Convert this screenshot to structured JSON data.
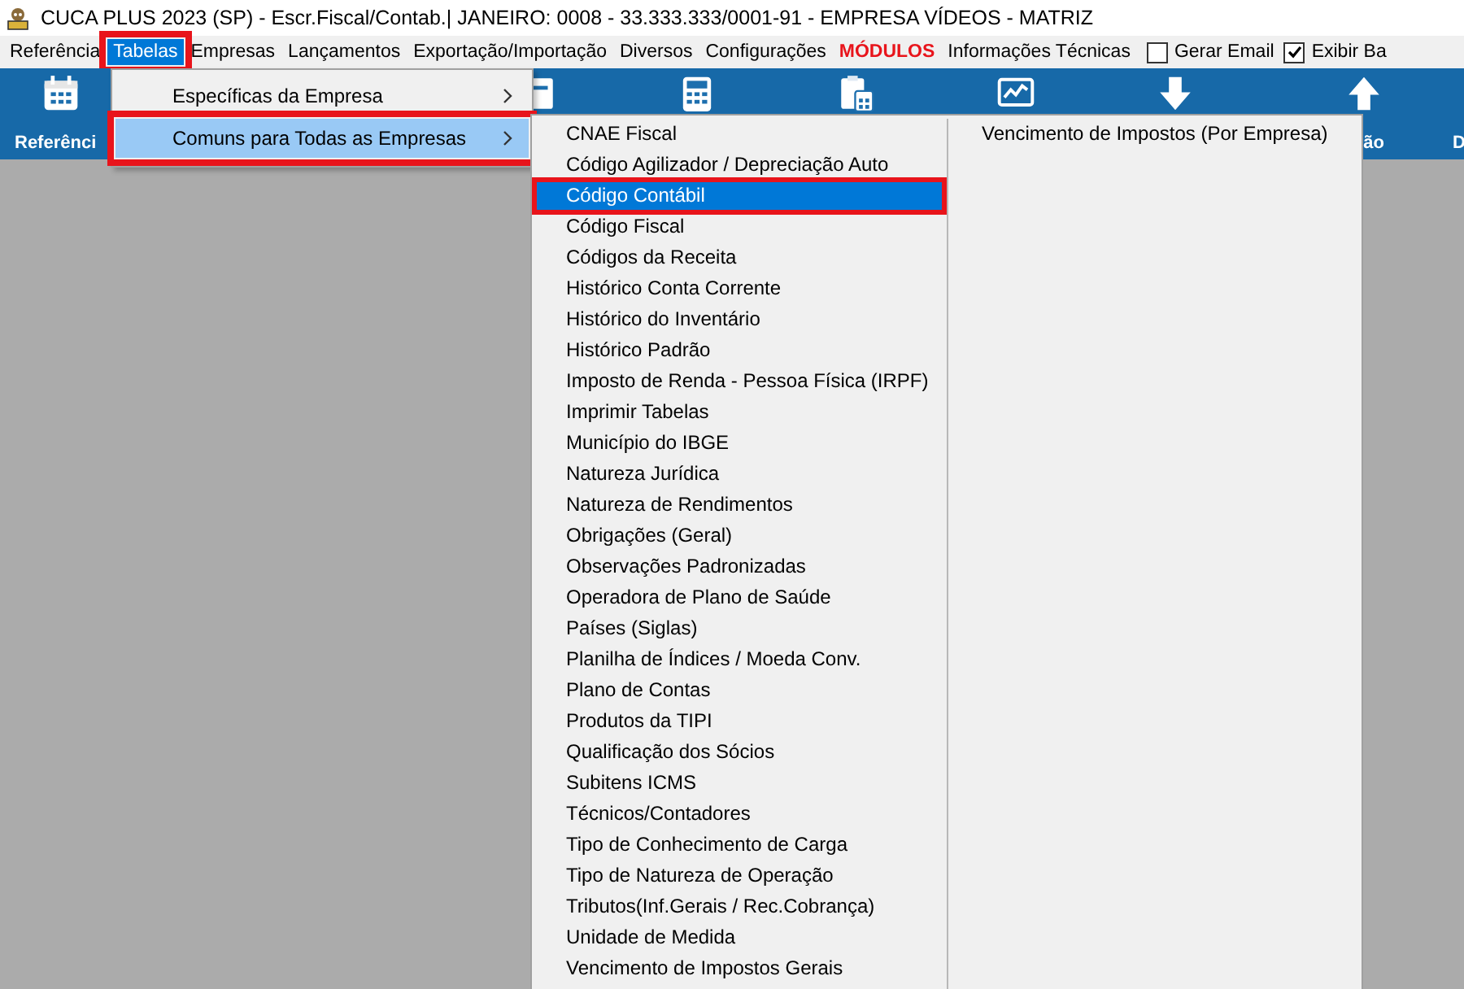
{
  "window": {
    "title": "CUCA PLUS 2023 (SP) - Escr.Fiscal/Contab.| JANEIRO: 0008 - 33.333.333/0001-91 - EMPRESA VÍDEOS - MATRIZ"
  },
  "menu_bar": {
    "items": [
      {
        "kind": "menu",
        "label": "Referência",
        "selected": false,
        "annotated": false
      },
      {
        "kind": "menu",
        "label": "Tabelas",
        "selected": true,
        "annotated": true
      },
      {
        "kind": "menu",
        "label": "Empresas",
        "selected": false,
        "annotated": false
      },
      {
        "kind": "menu",
        "label": "Lançamentos",
        "selected": false,
        "annotated": false
      },
      {
        "kind": "menu",
        "label": "Exportação/Importação",
        "selected": false,
        "annotated": false
      },
      {
        "kind": "menu",
        "label": "Diversos",
        "selected": false,
        "annotated": false
      },
      {
        "kind": "menu",
        "label": "Configurações",
        "selected": false,
        "annotated": false
      },
      {
        "kind": "highlight",
        "label": "MÓDULOS",
        "selected": false,
        "annotated": false
      },
      {
        "kind": "menu",
        "label": "Informações Técnicas",
        "selected": false,
        "annotated": false
      },
      {
        "kind": "checkbox",
        "label": "Gerar Email",
        "checked": false
      },
      {
        "kind": "checkbox",
        "label": "Exibir Ba",
        "checked": true
      }
    ]
  },
  "toolbar": {
    "labels": [
      "Referênci",
      "ão",
      "D"
    ]
  },
  "tabelas_menu": {
    "items": [
      {
        "label": "Específicas da Empresa",
        "selected": false,
        "annotated": false
      },
      {
        "label": "Comuns para Todas as Empresas",
        "selected": true,
        "annotated": true
      }
    ]
  },
  "submenu": {
    "columns": [
      [
        {
          "label": "CNAE Fiscal",
          "selected": false,
          "annotated": false
        },
        {
          "label": "Código Agilizador / Depreciação Auto",
          "selected": false,
          "annotated": false
        },
        {
          "label": "Código Contábil",
          "selected": true,
          "annotated": true
        },
        {
          "label": "Código Fiscal",
          "selected": false,
          "annotated": false
        },
        {
          "label": "Códigos da Receita",
          "selected": false,
          "annotated": false
        },
        {
          "label": "Histórico Conta Corrente",
          "selected": false,
          "annotated": false
        },
        {
          "label": "Histórico do Inventário",
          "selected": false,
          "annotated": false
        },
        {
          "label": "Histórico Padrão",
          "selected": false,
          "annotated": false
        },
        {
          "label": "Imposto de Renda - Pessoa Física (IRPF)",
          "selected": false,
          "annotated": false
        },
        {
          "label": "Imprimir Tabelas",
          "selected": false,
          "annotated": false
        },
        {
          "label": "Município do IBGE",
          "selected": false,
          "annotated": false
        },
        {
          "label": "Natureza Jurídica",
          "selected": false,
          "annotated": false
        },
        {
          "label": "Natureza de Rendimentos",
          "selected": false,
          "annotated": false
        },
        {
          "label": "Obrigações (Geral)",
          "selected": false,
          "annotated": false
        },
        {
          "label": "Observações Padronizadas",
          "selected": false,
          "annotated": false
        },
        {
          "label": "Operadora de Plano de Saúde",
          "selected": false,
          "annotated": false
        },
        {
          "label": "Países (Siglas)",
          "selected": false,
          "annotated": false
        },
        {
          "label": "Planilha de Índices / Moeda Conv.",
          "selected": false,
          "annotated": false
        },
        {
          "label": "Plano de Contas",
          "selected": false,
          "annotated": false
        },
        {
          "label": "Produtos da TIPI",
          "selected": false,
          "annotated": false
        },
        {
          "label": "Qualificação dos Sócios",
          "selected": false,
          "annotated": false
        },
        {
          "label": "Subitens ICMS",
          "selected": false,
          "annotated": false
        },
        {
          "label": "Técnicos/Contadores",
          "selected": false,
          "annotated": false
        },
        {
          "label": "Tipo de Conhecimento de Carga",
          "selected": false,
          "annotated": false
        },
        {
          "label": "Tipo de Natureza de Operação",
          "selected": false,
          "annotated": false
        },
        {
          "label": "Tributos(Inf.Gerais / Rec.Cobrança)",
          "selected": false,
          "annotated": false
        },
        {
          "label": "Unidade de Medida",
          "selected": false,
          "annotated": false
        },
        {
          "label": "Vencimento de Impostos Gerais",
          "selected": false,
          "annotated": false
        }
      ],
      [
        {
          "label": "Vencimento de Impostos (Por Empresa)",
          "selected": false,
          "annotated": false
        }
      ]
    ]
  }
}
